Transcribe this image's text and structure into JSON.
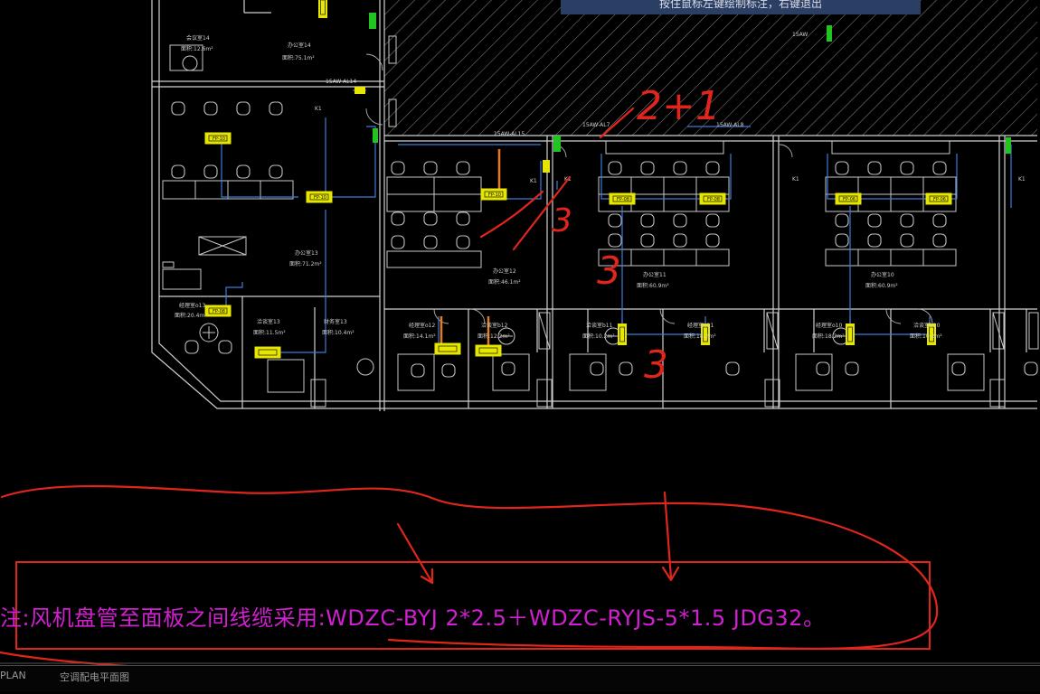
{
  "tooltip": "按住鼠标左键绘制标注，右键退出",
  "note_text": "注:风机盘管至面板之间线缆采用:WDZC-BYJ 2*2.5＋WDZC-RYJS-5*1.5  JDG32。",
  "tabs": {
    "plan": "PLAN",
    "sheet": "空调配电平面图"
  },
  "handwriting": {
    "top": "2+1",
    "mid": "3",
    "low": "3",
    "bottom": "3"
  },
  "rooms": {
    "office14": "办公室14",
    "office14_area": "面积:75.1m²",
    "meeting14": "会议室14",
    "meeting14_area": "面积:12.6m²",
    "office13": "办公室13",
    "office13_area": "面积:71.2m²",
    "office12": "办公室12",
    "office12_area": "面积:46.1m²",
    "office11": "办公室11",
    "office11_area": "面积:60.9m²",
    "office10": "办公室10",
    "office10_area": "面积:60.9m²",
    "mgr13": "经理室o13",
    "mgr13_area": "面积:20.4m²",
    "meet13": "洽谈室13",
    "meet13_area": "面积:11.5m²",
    "fin13": "财务室13",
    "fin13_area": "面积:10.4m²",
    "mgr12": "经理室o12",
    "mgr12_area": "面积:14.1m²",
    "meet12": "洽谈室b12",
    "meet12_area": "面积:12.2m²",
    "meet11": "洽谈室b11",
    "meet11_area": "面积:10.2m²",
    "mgr11": "经理室o11",
    "mgr11_area": "面积:18.2m²",
    "mgr10": "经理室o10",
    "mgr10_area": "面积:18.2m²",
    "meet10": "洽谈室b10",
    "meet10_area": "面积:10.2m²"
  },
  "circuits": {
    "c1": "15AW-AL14",
    "c2": "15AW-AL15",
    "c3": "15AW-AL7",
    "c4": "15AW-AL8",
    "c5": "15AW",
    "k1": "K1"
  },
  "fcu_labels": {
    "f10": "FP-10",
    "f08": "FP-08",
    "f06": "FP-06",
    "f04": "FP-04"
  },
  "colors": {
    "note": "#d21fd2",
    "annotation": "#e0261c",
    "wire_blue": "#3c7bd8",
    "fcu_yellow": "#e6e600",
    "walls": "#d0d0d0",
    "green": "#22c422",
    "orange": "#e67a1e"
  }
}
